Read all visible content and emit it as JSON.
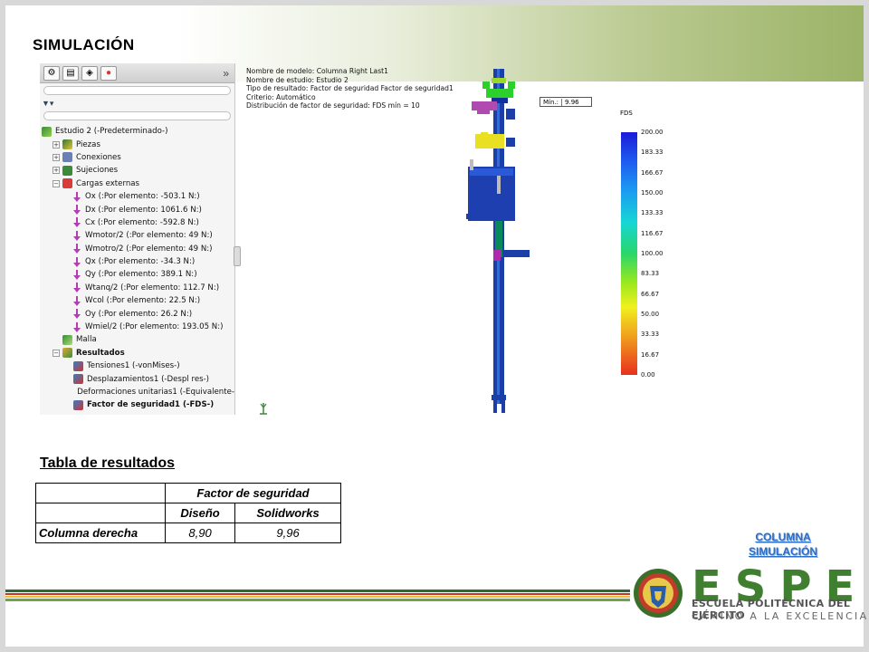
{
  "slide": {
    "title": "SIMULACIÓN"
  },
  "tree": {
    "tabs_chevron": "»",
    "rows": [
      {
        "label": "Estudio 2 (-Predeterminado-)",
        "icon": "study-icon"
      },
      {
        "label": "Piezas",
        "icon": "parts-icon"
      },
      {
        "label": "Conexiones",
        "icon": "connections-icon"
      },
      {
        "label": "Sujeciones",
        "icon": "fixtures-icon"
      },
      {
        "label": "Cargas externas",
        "icon": "external-loads-icon"
      },
      {
        "label": "Ox (:Por elemento: -503.1 N:)",
        "icon": "force-arrow-icon"
      },
      {
        "label": "Dx (:Por elemento: 1061.6 N:)",
        "icon": "force-arrow-icon"
      },
      {
        "label": "Cx (:Por elemento: -592.8 N:)",
        "icon": "force-arrow-icon"
      },
      {
        "label": "Wmotor/2 (:Por elemento: 49 N:)",
        "icon": "force-arrow-icon"
      },
      {
        "label": "Wmotro/2 (:Por elemento: 49 N:)",
        "icon": "force-arrow-icon"
      },
      {
        "label": "Qx (:Por elemento: -34.3 N:)",
        "icon": "force-arrow-icon"
      },
      {
        "label": "Qy (:Por elemento: 389.1 N:)",
        "icon": "force-arrow-icon"
      },
      {
        "label": "Wtanq/2 (:Por elemento: 112.7 N:)",
        "icon": "force-arrow-icon"
      },
      {
        "label": "Wcol (:Por elemento: 22.5 N:)",
        "icon": "force-arrow-icon"
      },
      {
        "label": "Oy (:Por elemento: 26.2 N:)",
        "icon": "force-arrow-icon"
      },
      {
        "label": "Wmiel/2 (:Por elemento: 193.05 N:)",
        "icon": "force-arrow-icon"
      },
      {
        "label": "Malla",
        "icon": "mesh-icon"
      },
      {
        "label": "Resultados",
        "icon": "results-folder-icon"
      },
      {
        "label": "Tensiones1 (-vonMises-)",
        "icon": "plot-icon"
      },
      {
        "label": "Desplazamientos1 (-Despl res-)",
        "icon": "plot-icon"
      },
      {
        "label": "Deformaciones unitarias1 (-Equivalente-",
        "icon": "plot-icon"
      },
      {
        "label": "Factor de seguridad1 (-FDS-)",
        "icon": "plot-icon"
      }
    ]
  },
  "model_info": {
    "line1": "Nombre de modelo: Columna Right Last1",
    "line2": "Nombre de estudio: Estudio 2",
    "line3": "Tipo de resultado: Factor de seguridad Factor de seguridad1",
    "line4": "Criterio: Automático",
    "line5": "Distribución de factor de seguridad: FDS mín = 10"
  },
  "min_marker": {
    "label": "Mín.:",
    "value": "9.96"
  },
  "legend": {
    "title": "FDS",
    "ticks": [
      "200.00",
      "183.33",
      "166.67",
      "150.00",
      "133.33",
      "116.67",
      "100.00",
      "83.33",
      "66.67",
      "50.00",
      "33.33",
      "16.67",
      "0.00"
    ]
  },
  "results": {
    "title": "Tabla de resultados",
    "group_header": "Factor de seguridad",
    "col1": "Diseño",
    "col2": "Solidworks",
    "row_label": "Columna derecha",
    "val1": "8,90",
    "val2": "9,96"
  },
  "nav": {
    "line1": "COLUMNA",
    "line2": "SIMULACIÓN"
  },
  "brand": {
    "letters": "ESPE",
    "sub1": "ESCUELA POLITÉCNICA DEL EJÉRCITO",
    "sub2": "CAMINO A LA EXCELENCIA"
  },
  "colors": {
    "accent_green": "#3f7f2f",
    "link_blue": "#2a6fc4",
    "stripe_red": "#c8312c",
    "stripe_yellow": "#e5c02f"
  }
}
